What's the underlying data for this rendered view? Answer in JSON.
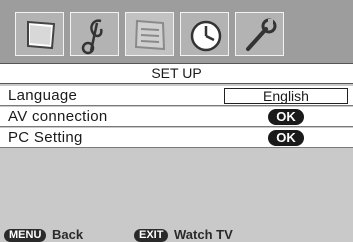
{
  "menu": {
    "icons": [
      {
        "name": "picture-icon"
      },
      {
        "name": "sound-icon"
      },
      {
        "name": "setup-icon"
      },
      {
        "name": "timer-icon"
      },
      {
        "name": "installation-icon"
      }
    ],
    "title": "SET UP",
    "items": [
      {
        "label": "Language",
        "value": "English"
      },
      {
        "label": "AV connection",
        "button": "OK"
      },
      {
        "label": "PC Setting",
        "button": "OK"
      }
    ]
  },
  "footer": {
    "back_key": "MENU",
    "back_label": "Back",
    "exit_key": "EXIT",
    "exit_label": "Watch TV"
  },
  "colors": {
    "background": "#c9c9c9",
    "icon_bar": "#9d9d9d",
    "row": "#ffffff",
    "ok_button": "#1a1a1a"
  }
}
